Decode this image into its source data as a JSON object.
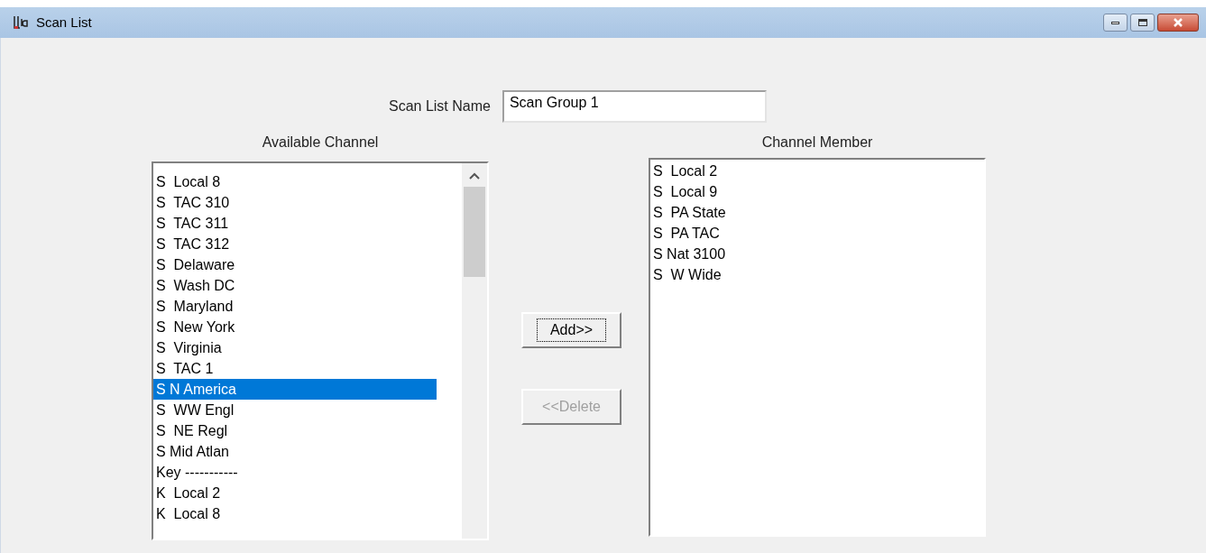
{
  "window": {
    "title": "Scan List"
  },
  "name_field": {
    "label": "Scan List Name",
    "value": "Scan Group 1"
  },
  "available": {
    "title": "Available Channel",
    "items": [
      {
        "label": "S  Local 8",
        "selected": false
      },
      {
        "label": "S  TAC 310",
        "selected": false
      },
      {
        "label": "S  TAC 311",
        "selected": false
      },
      {
        "label": "S  TAC 312",
        "selected": false
      },
      {
        "label": "S  Delaware",
        "selected": false
      },
      {
        "label": "S  Wash DC",
        "selected": false
      },
      {
        "label": "S  Maryland",
        "selected": false
      },
      {
        "label": "S  New York",
        "selected": false
      },
      {
        "label": "S  Virginia",
        "selected": false
      },
      {
        "label": "S  TAC 1",
        "selected": false
      },
      {
        "label": "S N America",
        "selected": true
      },
      {
        "label": "S  WW Engl",
        "selected": false
      },
      {
        "label": "S  NE Regl",
        "selected": false
      },
      {
        "label": "S Mid Atlan",
        "selected": false
      },
      {
        "label": "Key -----------",
        "selected": false
      },
      {
        "label": "K  Local 2",
        "selected": false
      },
      {
        "label": "K  Local 8",
        "selected": false
      }
    ]
  },
  "buttons": [
    {
      "label": "Add>>",
      "disabled": false,
      "focused": true
    },
    {
      "label": "<<Delete",
      "disabled": true,
      "focused": false
    }
  ],
  "members": {
    "title": "Channel Member",
    "items": [
      {
        "label": "S  Local 2",
        "selected": false
      },
      {
        "label": "S  Local 9",
        "selected": false
      },
      {
        "label": "S  PA State",
        "selected": false
      },
      {
        "label": "S  PA TAC",
        "selected": false
      },
      {
        "label": "S Nat 3100",
        "selected": false
      },
      {
        "label": "S  W Wide",
        "selected": false
      }
    ]
  }
}
